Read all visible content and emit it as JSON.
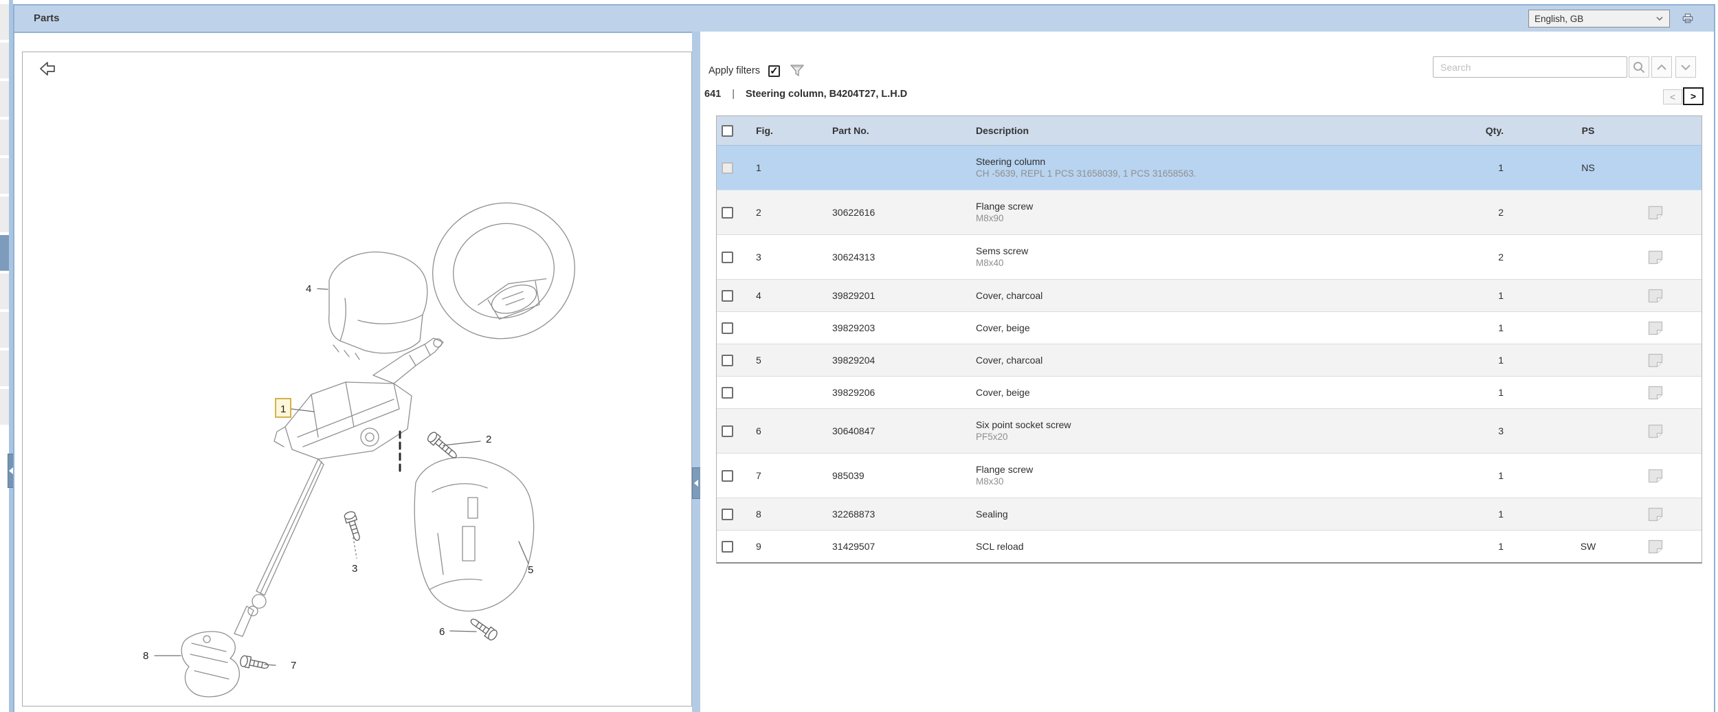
{
  "titlebar": {
    "title": "Parts",
    "language_value": "English, GB"
  },
  "icons": {
    "check": "✓"
  },
  "left_panel": {
    "diagram_callouts": [
      {
        "label": "1",
        "highlighted": true
      },
      {
        "label": "2"
      },
      {
        "label": "3"
      },
      {
        "label": "4"
      },
      {
        "label": "5"
      },
      {
        "label": "6"
      },
      {
        "label": "7"
      },
      {
        "label": "8"
      }
    ]
  },
  "right_panel": {
    "apply_filters_label": "Apply filters",
    "filters_checkbox_checked": true,
    "section": {
      "code": "641",
      "separator": "|",
      "title": "Steering column, B4204T27, L.H.D"
    },
    "search": {
      "placeholder": "Search"
    },
    "pagination": {
      "prev_label": "<",
      "next_label": ">"
    },
    "table": {
      "headers": {
        "fig": "Fig.",
        "part_no": "Part No.",
        "description": "Description",
        "qty": "Qty.",
        "ps": "PS"
      },
      "rows": [
        {
          "fig": "1",
          "part_no": "",
          "description": "Steering column",
          "sub_description": "CH -5639, REPL 1 PCS 31658039, 1 PCS 31658563.",
          "qty": "1",
          "ps": "NS",
          "selected": true,
          "checkbox_disabled": true,
          "has_note": false
        },
        {
          "fig": "2",
          "part_no": "30622616",
          "description": "Flange screw",
          "sub_description": "M8x90",
          "qty": "2",
          "ps": "",
          "has_note": true
        },
        {
          "fig": "3",
          "part_no": "30624313",
          "description": "Sems screw",
          "sub_description": "M8x40",
          "qty": "2",
          "ps": "",
          "has_note": true
        },
        {
          "fig": "4",
          "part_no": "39829201",
          "description": "Cover, charcoal",
          "sub_description": "",
          "qty": "1",
          "ps": "",
          "has_note": true
        },
        {
          "fig": "",
          "part_no": "39829203",
          "description": "Cover, beige",
          "sub_description": "",
          "qty": "1",
          "ps": "",
          "has_note": true
        },
        {
          "fig": "5",
          "part_no": "39829204",
          "description": "Cover, charcoal",
          "sub_description": "",
          "qty": "1",
          "ps": "",
          "has_note": true
        },
        {
          "fig": "",
          "part_no": "39829206",
          "description": "Cover, beige",
          "sub_description": "",
          "qty": "1",
          "ps": "",
          "has_note": true
        },
        {
          "fig": "6",
          "part_no": "30640847",
          "description": "Six point socket screw",
          "sub_description": "PF5x20",
          "qty": "3",
          "ps": "",
          "has_note": true
        },
        {
          "fig": "7",
          "part_no": "985039",
          "description": "Flange screw",
          "sub_description": "M8x30",
          "qty": "1",
          "ps": "",
          "has_note": true
        },
        {
          "fig": "8",
          "part_no": "32268873",
          "description": "Sealing",
          "sub_description": "",
          "qty": "1",
          "ps": "",
          "has_note": true
        },
        {
          "fig": "9",
          "part_no": "31429507",
          "description": "SCL reload",
          "sub_description": "",
          "qty": "1",
          "ps": "SW",
          "has_note": true
        }
      ]
    }
  },
  "colors": {
    "titlebar_bg": "#bed3ea",
    "selected_row_bg": "#b8d4f0",
    "table_header_bg": "#cfdcec",
    "highlight_box_border": "#c9a227"
  }
}
